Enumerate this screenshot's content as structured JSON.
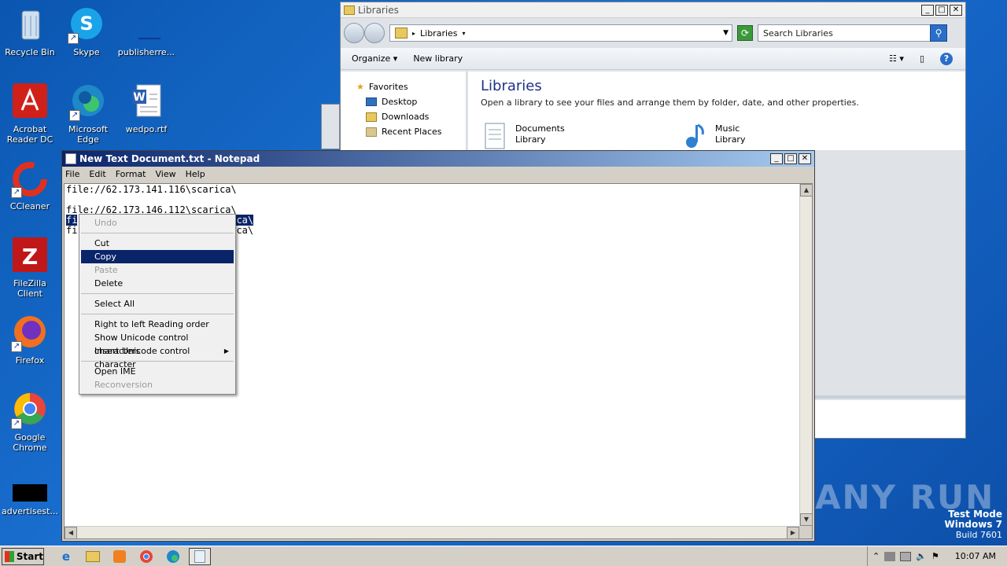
{
  "desktop": {
    "icons": [
      {
        "label": "Recycle Bin",
        "icon": "recycle-bin-icon"
      },
      {
        "label": "Skype",
        "icon": "skype-icon"
      },
      {
        "label": "publisherre...",
        "icon": "file-icon"
      },
      {
        "label": "Acrobat Reader DC",
        "icon": "acrobat-icon"
      },
      {
        "label": "Microsoft Edge",
        "icon": "edge-icon"
      },
      {
        "label": "wedpo.rtf",
        "icon": "word-doc-icon"
      },
      {
        "label": "CCleaner",
        "icon": "ccleaner-icon"
      },
      {
        "label": "FileZilla Client",
        "icon": "filezilla-icon"
      },
      {
        "label": "Firefox",
        "icon": "firefox-icon"
      },
      {
        "label": "Google Chrome",
        "icon": "chrome-icon"
      },
      {
        "label": "advertisest...",
        "icon": "file-icon"
      }
    ]
  },
  "libraries_window": {
    "title": "Libraries",
    "address": "Libraries",
    "search_placeholder": "Search Libraries",
    "toolbar": {
      "organize": "Organize",
      "new_library": "New library"
    },
    "nav": {
      "favorites": "Favorites",
      "items": [
        "Desktop",
        "Downloads",
        "Recent Places"
      ]
    },
    "heading": "Libraries",
    "description": "Open a library to see your files and arrange them by folder, date, and other properties.",
    "libraries": [
      {
        "name": "Documents",
        "sub": "Library"
      },
      {
        "name": "Music",
        "sub": "Library"
      }
    ]
  },
  "notepad": {
    "title": "New Text Document.txt - Notepad",
    "menu": [
      "File",
      "Edit",
      "Format",
      "View",
      "Help"
    ],
    "lines": [
      "file://62.173.141.116\\scarica\\",
      "",
      "file://62.173.146.112\\scarica\\",
      "fi",
      "fi"
    ],
    "selected_tail": "ca\\",
    "tail_line5": "ca\\"
  },
  "context_menu": {
    "items": [
      {
        "label": "Undo",
        "disabled": true
      },
      {
        "sep": true
      },
      {
        "label": "Cut",
        "disabled": false
      },
      {
        "label": "Copy",
        "disabled": false,
        "highlighted": true
      },
      {
        "label": "Paste",
        "disabled": true
      },
      {
        "label": "Delete",
        "disabled": false
      },
      {
        "sep": true
      },
      {
        "label": "Select All",
        "disabled": false
      },
      {
        "sep": true
      },
      {
        "label": "Right to left Reading order",
        "disabled": false
      },
      {
        "label": "Show Unicode control characters",
        "disabled": false
      },
      {
        "label": "Insert Unicode control character",
        "disabled": false,
        "submenu": true
      },
      {
        "sep": true
      },
      {
        "label": "Open IME",
        "disabled": false
      },
      {
        "label": "Reconversion",
        "disabled": true
      }
    ]
  },
  "taskbar": {
    "start_label": "Start",
    "clock": "10:07 AM"
  },
  "watermark": {
    "brand": "ANY RUN",
    "test_mode": "Test Mode",
    "os": "Windows 7",
    "build": "Build 7601"
  }
}
